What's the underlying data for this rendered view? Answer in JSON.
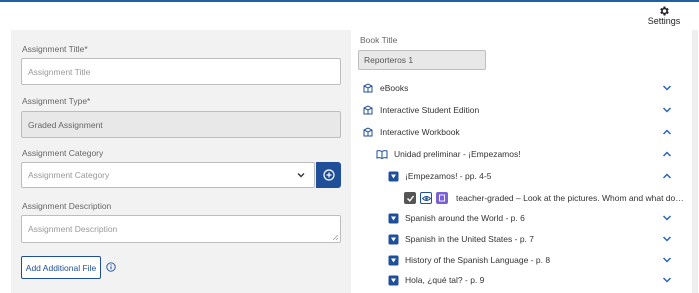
{
  "settings": {
    "label": "Settings",
    "icon": "gear-icon"
  },
  "form": {
    "assignment_title": {
      "label": "Assignment Title*",
      "placeholder": "Assignment Title"
    },
    "assignment_type": {
      "label": "Assignment Type*",
      "value": "Graded Assignment"
    },
    "assignment_category": {
      "label": "Assignment Category",
      "placeholder": "Assignment Category"
    },
    "assignment_description": {
      "label": "Assignment Description",
      "placeholder": "Assignment Description"
    },
    "add_file_button": "Add Additional File"
  },
  "book": {
    "label": "Book Title",
    "value": "Reporteros 1"
  },
  "tree": {
    "items": [
      {
        "label": "eBooks",
        "icon": "book-stack-icon",
        "expanded": false
      },
      {
        "label": "Interactive Student Edition",
        "icon": "book-stack-icon",
        "expanded": false
      },
      {
        "label": "Interactive Workbook",
        "icon": "book-stack-icon",
        "expanded": true
      },
      {
        "label": "Unidad preliminar - ¡Empezamos!",
        "icon": "open-book-icon",
        "expanded": true
      },
      {
        "label": "¡Empezamos! - pp. 4-5",
        "icon": "slides-icon",
        "expanded": true
      },
      {
        "label": "teacher-graded – Look at the pictures. Whom and what do you ...",
        "icon": "activity-icons"
      },
      {
        "label": "Spanish around the World - p. 6",
        "icon": "slides-icon",
        "expanded": false
      },
      {
        "label": "Spanish in the United States - p. 7",
        "icon": "slides-icon",
        "expanded": false
      },
      {
        "label": "History of the Spanish Language - p. 8",
        "icon": "slides-icon",
        "expanded": false
      },
      {
        "label": "Hola, ¿qué tal? - p. 9",
        "icon": "slides-icon",
        "expanded": false
      }
    ]
  },
  "colors": {
    "accent": "#1f4f99",
    "chevron": "#2a66b8",
    "purple": "#7b61d6"
  }
}
